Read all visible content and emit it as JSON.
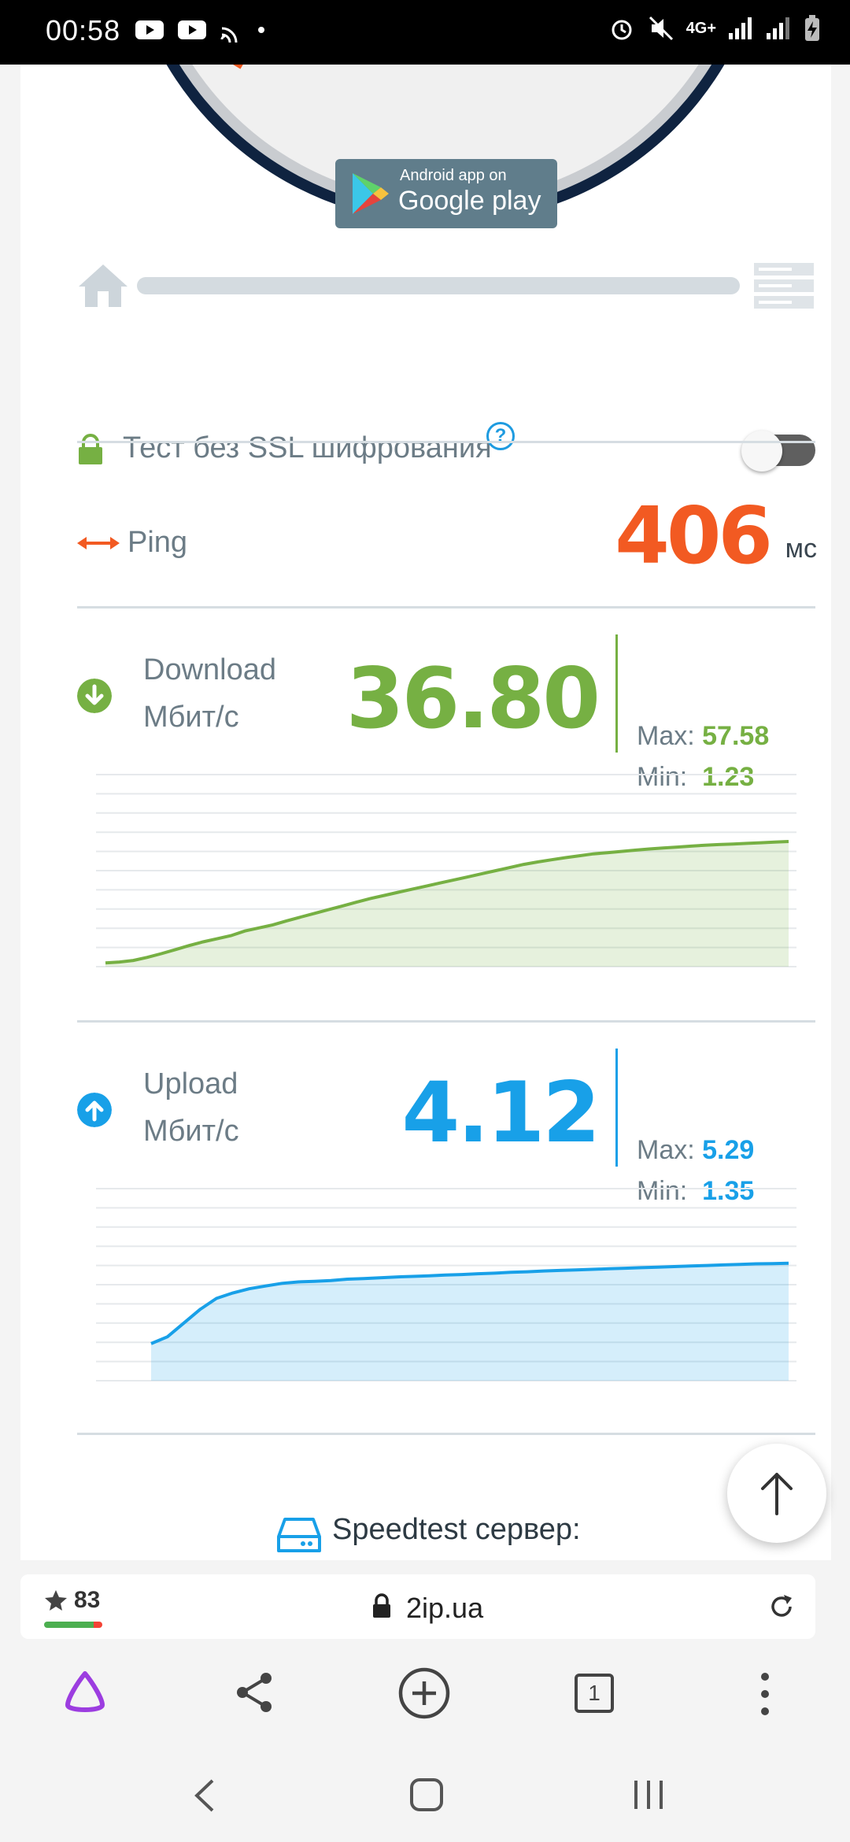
{
  "status_bar": {
    "time": "00:58",
    "network": "4G+"
  },
  "play_badge": {
    "line1": "Android app on",
    "line2": "Google play"
  },
  "ssl": {
    "label": "Тест без SSL шифрования",
    "help": "?",
    "enabled": false
  },
  "ping": {
    "label": "Ping",
    "value": "406",
    "unit": "мс"
  },
  "download": {
    "label": "Download",
    "unit": "Мбит/с",
    "value": "36.80",
    "max_label": "Max:",
    "max": "57.58",
    "min_label": "Min:",
    "min": "1.23",
    "color": "#76b043"
  },
  "upload": {
    "label": "Upload",
    "unit": "Мбит/с",
    "value": "4.12",
    "max_label": "Max:",
    "max": "5.29",
    "min_label": "Min:",
    "min": "1.35",
    "color": "#18a0e8"
  },
  "speedtest": {
    "label": "Speedtest сервер:"
  },
  "address_bar": {
    "rating": "83",
    "url": "2ip.ua"
  },
  "tab_count": "1",
  "chart_data": [
    {
      "type": "area",
      "series": [
        {
          "values": [
            1.2,
            1.5,
            2.0,
            3.0,
            4.2,
            5.5,
            6.8,
            8.0,
            9.0,
            10.0,
            11.5,
            12.5,
            13.5,
            14.8,
            16.0,
            17.2,
            18.4,
            19.6,
            20.8,
            22.0,
            23.0,
            24.0,
            25.0,
            26.0,
            27.0,
            28.0,
            29.0,
            30.0,
            31.0,
            32.0,
            33.0,
            33.8,
            34.5,
            35.2,
            35.8,
            36.4,
            36.8,
            37.2,
            37.6,
            38.0,
            38.3,
            38.6,
            38.9,
            39.2,
            39.4,
            39.6,
            39.8,
            40.0,
            40.2,
            40.4
          ]
        }
      ],
      "ylim": [
        0,
        62
      ],
      "grid": true,
      "color": "#76b043"
    },
    {
      "type": "area",
      "series": [
        {
          "values": [
            1.35,
            1.6,
            2.1,
            2.6,
            3.0,
            3.2,
            3.35,
            3.45,
            3.55,
            3.6,
            3.62,
            3.65,
            3.7,
            3.72,
            3.75,
            3.78,
            3.8,
            3.82,
            3.85,
            3.87,
            3.9,
            3.92,
            3.95,
            3.97,
            4.0,
            4.02,
            4.04,
            4.06,
            4.08,
            4.1,
            4.12,
            4.14,
            4.16,
            4.18,
            4.2,
            4.22,
            4.24,
            4.26,
            4.27,
            4.28
          ]
        }
      ],
      "ylim": [
        0,
        7
      ],
      "grid": true,
      "color": "#18a0e8"
    }
  ]
}
